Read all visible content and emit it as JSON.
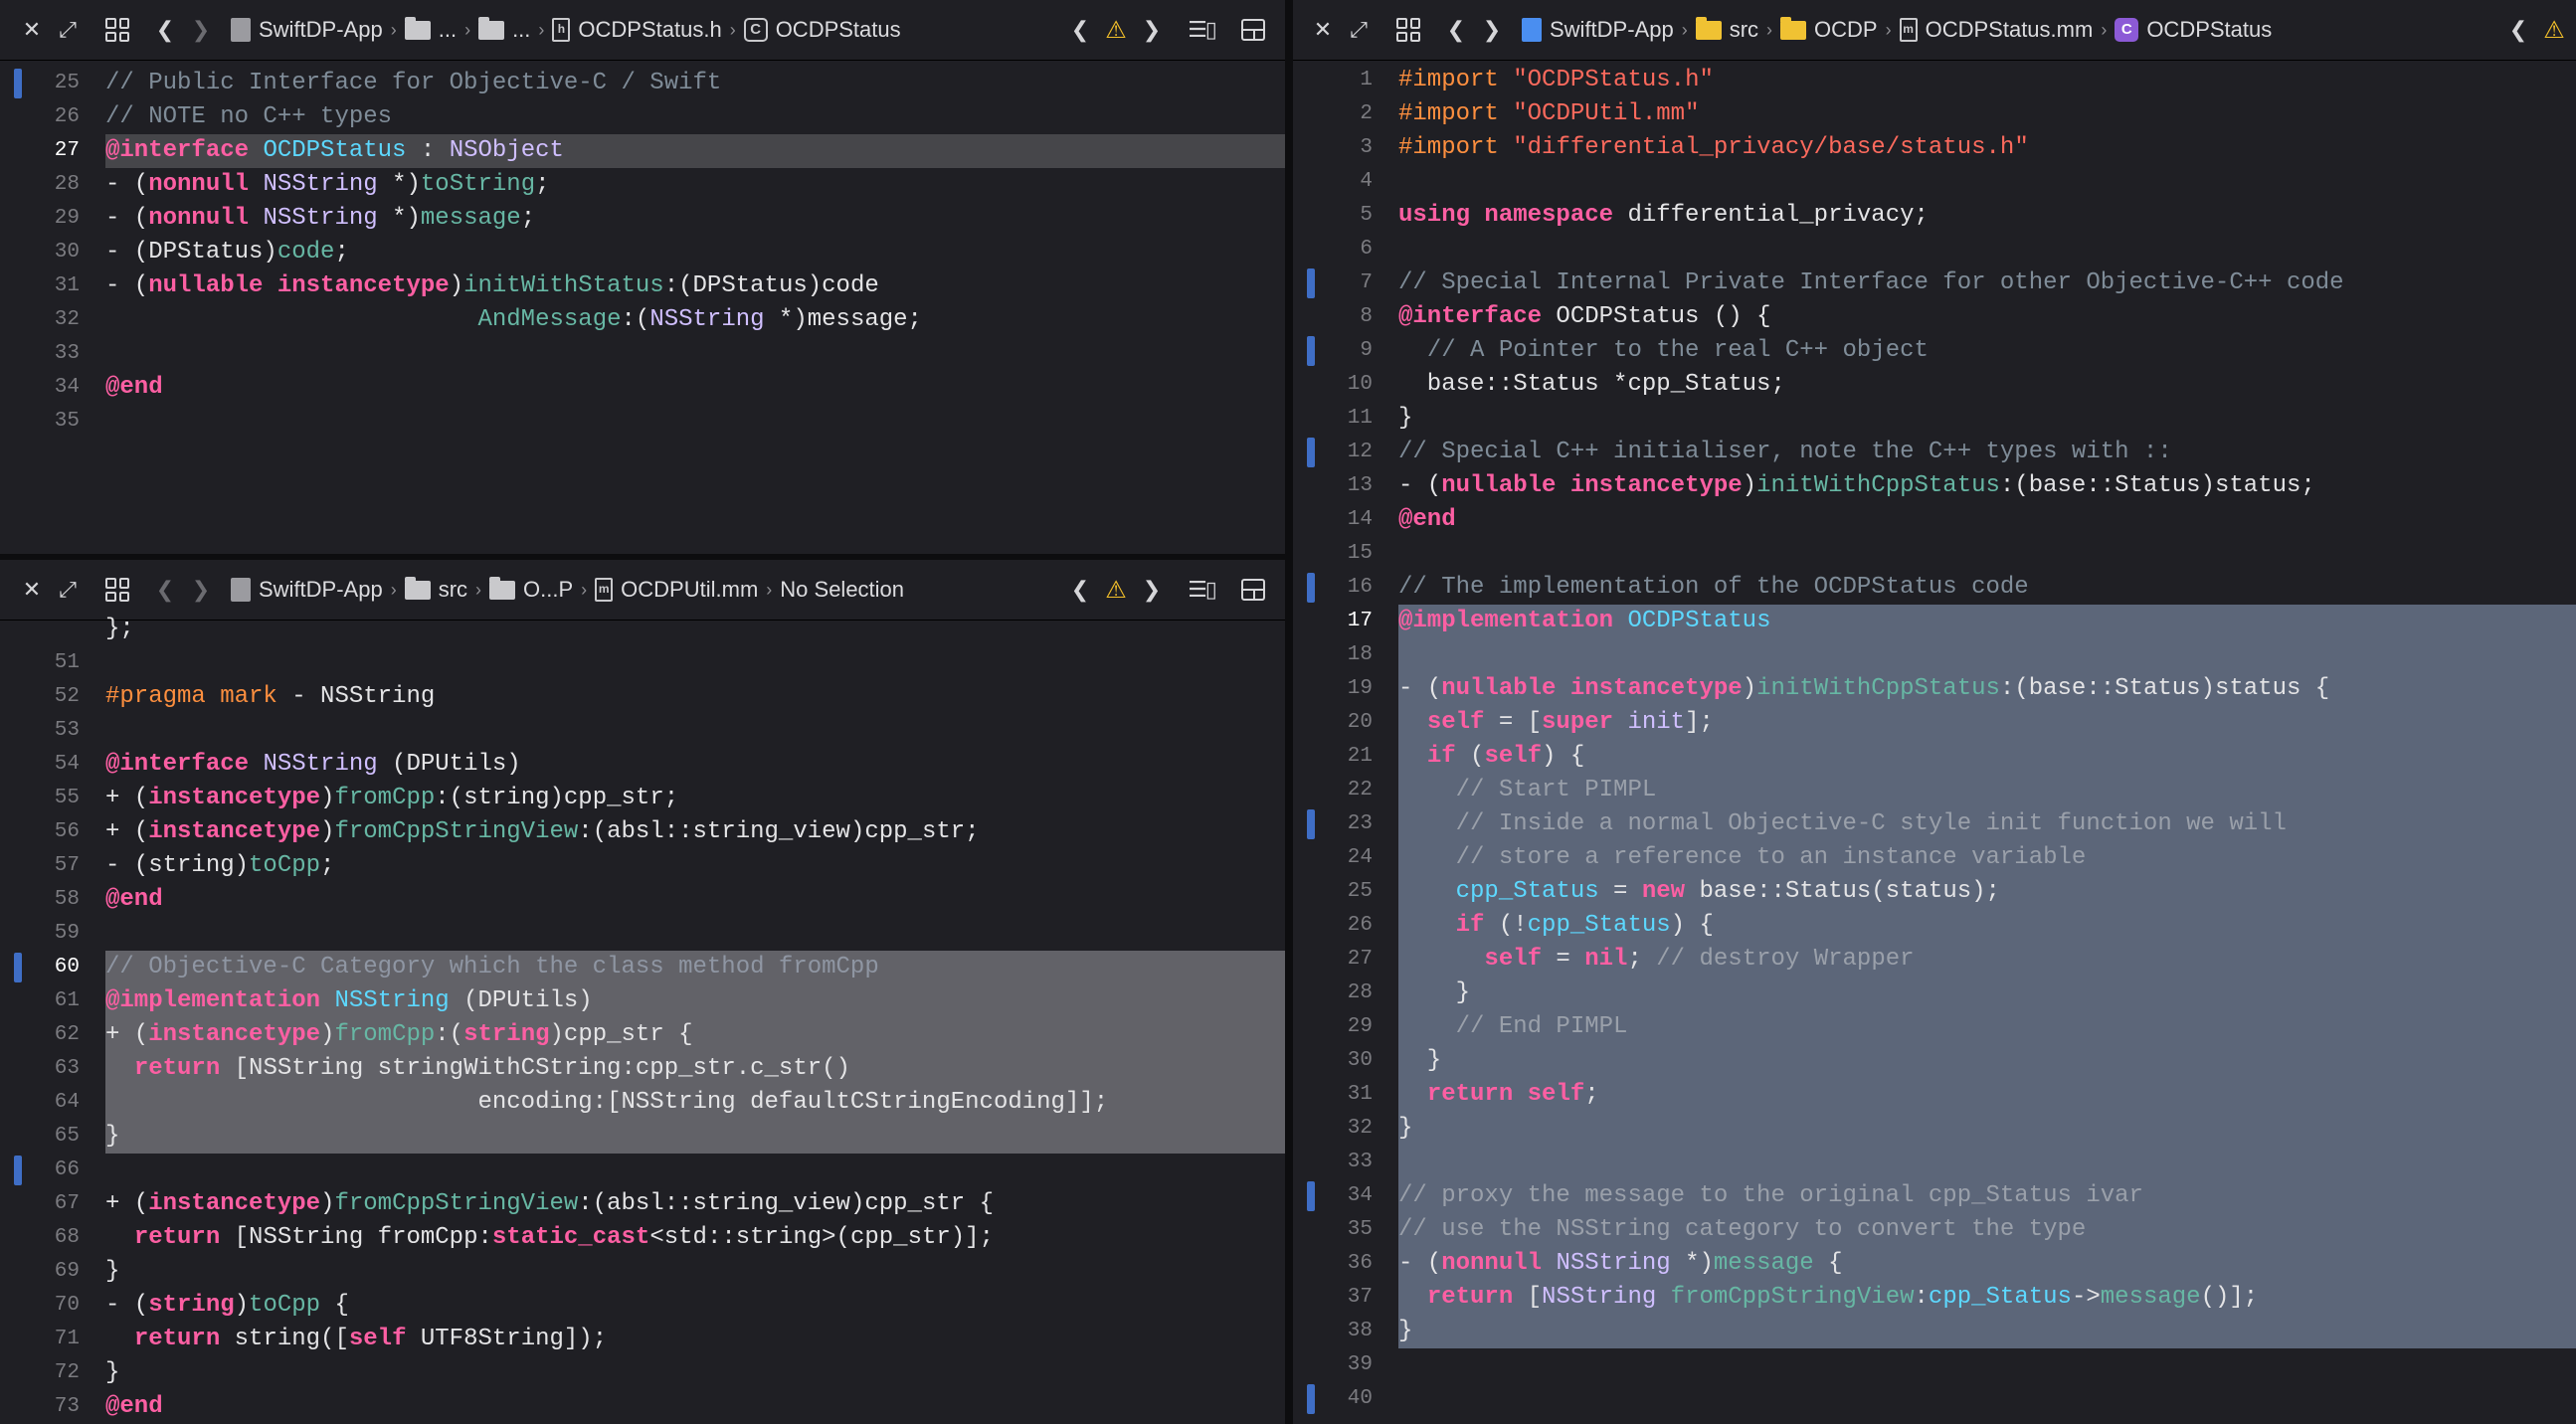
{
  "panes": {
    "top_left": {
      "breadcrumb": [
        "SwiftDP-App",
        "...",
        "...",
        "OCDPStatus.h",
        "OCDPStatus"
      ],
      "lines": [
        {
          "n": "25",
          "m": true,
          "t": "<span class=\"cm\">// Public Interface for Objective-C / Swift</span>"
        },
        {
          "n": "26",
          "t": "<span class=\"cm\">// NOTE no C++ types</span>"
        },
        {
          "n": "27",
          "cur": true,
          "hl": "row",
          "t": "<span class=\"kw\">@interface</span> <span class=\"cl\">OCDPStatus</span> : <span class=\"ty\">NSObject</span>"
        },
        {
          "n": "28",
          "t": "- (<span class=\"kw\">nonnull</span> <span class=\"ty\">NSString</span> *)<span class=\"fn\">toString</span>;"
        },
        {
          "n": "29",
          "t": "- (<span class=\"kw\">nonnull</span> <span class=\"ty\">NSString</span> *)<span class=\"fn\">message</span>;"
        },
        {
          "n": "30",
          "t": "- (DPStatus)<span class=\"fn\">code</span>;"
        },
        {
          "n": "31",
          "t": "- (<span class=\"kw\">nullable</span> <span class=\"kw\">instancetype</span>)<span class=\"fn\">initWithStatus</span>:(DPStatus)code"
        },
        {
          "n": "32",
          "t": "                          <span class=\"fn\">AndMessage</span>:(<span class=\"ty\">NSString</span> *)message;"
        },
        {
          "n": "33",
          "t": ""
        },
        {
          "n": "34",
          "t": "<span class=\"kw\">@end</span>"
        },
        {
          "n": "35",
          "t": ""
        }
      ]
    },
    "bottom_left": {
      "breadcrumb": [
        "SwiftDP-App",
        "src",
        "O...P",
        "OCDPUtil.mm",
        "No Selection"
      ],
      "lines": [
        {
          "n": "",
          "t": "};"
        },
        {
          "n": "51",
          "t": ""
        },
        {
          "n": "52",
          "t": "<span class=\"pp\">#pragma mark</span> - NSString"
        },
        {
          "n": "53",
          "t": ""
        },
        {
          "n": "54",
          "t": "<span class=\"kw\">@interface</span> <span class=\"ty\">NSString</span> (DPUtils)"
        },
        {
          "n": "55",
          "t": "+ (<span class=\"kw\">instancetype</span>)<span class=\"fn\">fromCpp</span>:(string)cpp_str;"
        },
        {
          "n": "56",
          "t": "+ (<span class=\"kw\">instancetype</span>)<span class=\"fn\">fromCppStringView</span>:(absl::string_view)cpp_str;"
        },
        {
          "n": "57",
          "t": "- (string)<span class=\"fn\">toCpp</span>;"
        },
        {
          "n": "58",
          "t": "<span class=\"kw\">@end</span>"
        },
        {
          "n": "59",
          "t": ""
        },
        {
          "n": "60",
          "m": true,
          "cur": true,
          "hl": "sel",
          "t": "<span class=\"cm-dim\">// Objective-C Category which the class method fromCpp</span>"
        },
        {
          "n": "61",
          "hl": "sel",
          "t": "<span class=\"kw\">@implementation</span> <span class=\"cl\">NSString</span> (DPUtils)"
        },
        {
          "n": "62",
          "hl": "sel",
          "t": "+ (<span class=\"kw\">instancetype</span>)<span class=\"fn\">fromCpp</span>:(<span class=\"kw\">string</span>)cpp_str {"
        },
        {
          "n": "63",
          "hl": "sel",
          "t": "  <span class=\"kw\">return</span> [NSString stringWithCString:cpp_str.c_str()"
        },
        {
          "n": "64",
          "hl": "sel",
          "t": "                          encoding:[NSString defaultCStringEncoding]];"
        },
        {
          "n": "65",
          "hl": "sel",
          "t": "}"
        },
        {
          "n": "66",
          "m": true,
          "t": ""
        },
        {
          "n": "67",
          "t": "+ (<span class=\"kw\">instancetype</span>)<span class=\"fn\">fromCppStringView</span>:(absl::string_view)cpp_str {"
        },
        {
          "n": "68",
          "t": "  <span class=\"kw\">return</span> [NSString fromCpp:<span class=\"kw\">static_cast</span>&lt;std::string&gt;(cpp_str)];"
        },
        {
          "n": "69",
          "t": "}"
        },
        {
          "n": "70",
          "t": "- (<span class=\"kw\">string</span>)<span class=\"fn\">toCpp</span> {"
        },
        {
          "n": "71",
          "t": "  <span class=\"kw\">return</span> string([<span class=\"kw\">self</span> UTF8String]);"
        },
        {
          "n": "72",
          "t": "}"
        },
        {
          "n": "73",
          "t": "<span class=\"kw\">@end</span>"
        }
      ]
    },
    "right": {
      "breadcrumb": [
        "SwiftDP-App",
        "src",
        "OCDP",
        "OCDPStatus.mm",
        "OCDPStatus"
      ],
      "lines": [
        {
          "n": "1",
          "t": "<span class=\"pp\">#import</span> <span class=\"st\">\"OCDPStatus.h\"</span>"
        },
        {
          "n": "2",
          "t": "<span class=\"pp\">#import</span> <span class=\"st\">\"OCDPUtil.mm\"</span>"
        },
        {
          "n": "3",
          "t": "<span class=\"pp\">#import</span> <span class=\"st\">\"differential_privacy/base/status.h\"</span>"
        },
        {
          "n": "4",
          "t": ""
        },
        {
          "n": "5",
          "t": "<span class=\"kw\">using namespace</span> differential_privacy;"
        },
        {
          "n": "6",
          "t": ""
        },
        {
          "n": "7",
          "m": true,
          "t": "<span class=\"cm\">// Special Internal Private Interface for other Objective-C++ code</span>"
        },
        {
          "n": "8",
          "t": "<span class=\"kw\">@interface</span> OCDPStatus () {"
        },
        {
          "n": "9",
          "m": true,
          "t": "  <span class=\"cm\">// A Pointer to the real C++ object</span>"
        },
        {
          "n": "10",
          "t": "  base::Status *cpp_Status;"
        },
        {
          "n": "11",
          "t": "}"
        },
        {
          "n": "12",
          "m": true,
          "t": "<span class=\"cm\">// Special C++ initialiser, note the C++ types with ::</span>"
        },
        {
          "n": "13",
          "t": "- (<span class=\"kw\">nullable</span> <span class=\"kw\">instancetype</span>)<span class=\"fn\">initWithCppStatus</span>:(base::Status)status;"
        },
        {
          "n": "14",
          "t": "<span class=\"kw\">@end</span>"
        },
        {
          "n": "15",
          "t": ""
        },
        {
          "n": "16",
          "m": true,
          "t": "<span class=\"cm\">// The implementation of the OCDPStatus code</span>"
        },
        {
          "n": "17",
          "cur": true,
          "hl": "blue",
          "t": "<span class=\"kw\">@implementation</span> <span class=\"cl\">OCDPStatus</span>"
        },
        {
          "n": "18",
          "hl": "blue",
          "t": ""
        },
        {
          "n": "19",
          "hl": "blue",
          "t": "- (<span class=\"kw\">nullable</span> <span class=\"kw\">instancetype</span>)<span class=\"fn\">initWithCppStatus</span>:(base::Status)status {"
        },
        {
          "n": "20",
          "hl": "blue",
          "t": "  <span class=\"kw\">self</span> = [<span class=\"kw\">super</span> <span class=\"ty\">init</span>];"
        },
        {
          "n": "21",
          "hl": "blue",
          "t": "  <span class=\"kw\">if</span> (<span class=\"kw\">self</span>) {"
        },
        {
          "n": "22",
          "hl": "blue",
          "t": "    <span class=\"cm-faint\">// Start PIMPL</span>"
        },
        {
          "n": "23",
          "m": true,
          "hl": "blue",
          "t": "    <span class=\"cm-faint\">// Inside a normal Objective-C style init function we will</span>"
        },
        {
          "n": "24",
          "hl": "blue",
          "t": "    <span class=\"cm-faint\">// store a reference to an instance variable</span>"
        },
        {
          "n": "25",
          "hl": "blue",
          "t": "    <span class=\"cl\">cpp_Status</span> = <span class=\"kw\">new</span> base::Status(status);"
        },
        {
          "n": "26",
          "hl": "blue",
          "t": "    <span class=\"kw\">if</span> (!<span class=\"cl\">cpp_Status</span>) {"
        },
        {
          "n": "27",
          "hl": "blue",
          "t": "      <span class=\"kw\">self</span> = <span class=\"kw\">nil</span>; <span class=\"cm-faint\">// destroy Wrapper</span>"
        },
        {
          "n": "28",
          "hl": "blue",
          "t": "    }"
        },
        {
          "n": "29",
          "hl": "blue",
          "t": "    <span class=\"cm-faint\">// End PIMPL</span>"
        },
        {
          "n": "30",
          "hl": "blue",
          "t": "  }"
        },
        {
          "n": "31",
          "hl": "blue",
          "t": "  <span class=\"kw\">return</span> <span class=\"kw\">self</span>;"
        },
        {
          "n": "32",
          "hl": "blue",
          "t": "}"
        },
        {
          "n": "33",
          "hl": "blue",
          "t": ""
        },
        {
          "n": "34",
          "m": true,
          "hl": "blue",
          "t": "<span class=\"cm-faint\">// proxy the message to the original cpp_Status ivar</span>"
        },
        {
          "n": "35",
          "hl": "blue",
          "t": "<span class=\"cm-faint\">// use the NSString category to convert the type</span>"
        },
        {
          "n": "36",
          "hl": "blue",
          "t": "- (<span class=\"kw\">nonnull</span> <span class=\"ty\">NSString</span> *)<span class=\"fn\">message</span> {"
        },
        {
          "n": "37",
          "hl": "blue",
          "t": "  <span class=\"kw\">return</span> [<span class=\"ty\">NSString</span> <span class=\"fn\">fromCppStringView</span>:<span class=\"cl\">cpp_Status</span>-&gt;<span class=\"fn\">message</span>()];"
        },
        {
          "n": "38",
          "hl": "blue",
          "t": "}"
        },
        {
          "n": "39",
          "t": ""
        },
        {
          "n": "40",
          "m": true,
          "t": ""
        }
      ]
    }
  }
}
